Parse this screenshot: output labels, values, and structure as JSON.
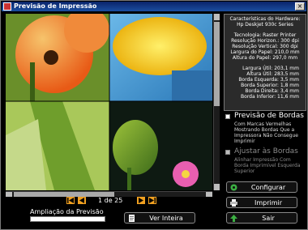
{
  "window": {
    "title": "Previsão de Impressão"
  },
  "hardware": {
    "heading": "Características do Hardware:",
    "printer": "Hp Deskjet 930c Series",
    "lines": [
      "Tecnologia: Raster Printer",
      "Resolução Horizon.: 300 dpi",
      "Resolução Vertical: 300 dpi",
      "Largura do Papel: 210,0 mm",
      "Altura do Papel: 297,0 mm"
    ],
    "measures": [
      "Largura Útil: 203,1 mm",
      "Altura Útil: 283,5 mm",
      "Borda Esquerda: 3,5 mm",
      "Borda Superior: 1,8 mm",
      "Borda Direita: 3,4 mm",
      "Borda Inferior: 11,6 mm"
    ]
  },
  "options": {
    "borders_preview": {
      "title": "Previsão de Bordas",
      "desc": [
        "Com Marcas Vermelhas",
        "Mostrando Bordas Que a",
        "Impressora Não Consegue",
        "Imprimir"
      ]
    },
    "adjust_borders": {
      "title": "Ajustar às Bordas",
      "desc": [
        "Alinhar Impressão Com",
        "Borda Imprimível Esquerda",
        "Superior"
      ]
    }
  },
  "pager": {
    "label": "1 de 25"
  },
  "zoom": {
    "label": "Ampliação da Previsão",
    "level_fraction": 0
  },
  "buttons": {
    "view_full": "Ver Inteira",
    "configure": "Configurar",
    "print": "Imprimir",
    "exit": "Sair"
  },
  "colors": {
    "accent": "#f0a020",
    "configure_icon": "#3cb043",
    "exit_icon": "#3cb043"
  }
}
